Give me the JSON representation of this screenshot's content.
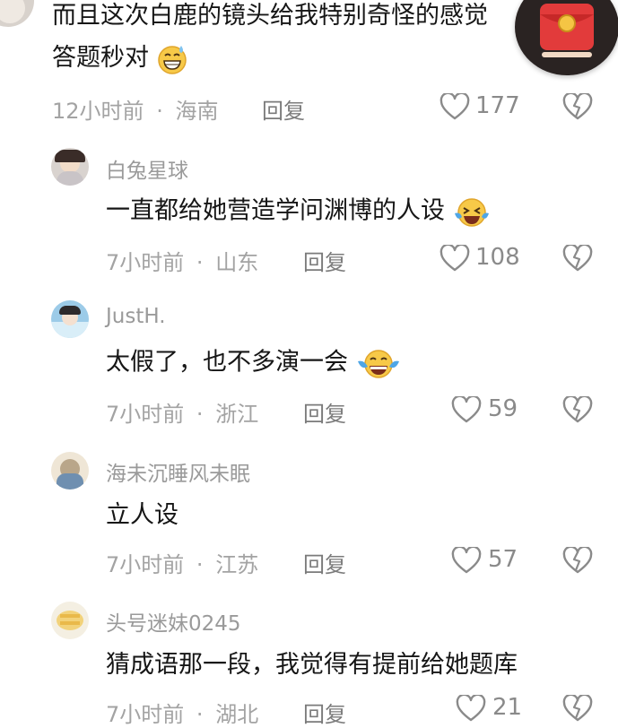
{
  "top_comment": {
    "text_line1": "而且这次白鹿的镜头给我特别奇怪的感觉",
    "text_line2": "答题秒对",
    "time": "12小时前",
    "location": "海南",
    "reply_label": "回复",
    "likes": "177"
  },
  "replies": [
    {
      "username": "白兔星球",
      "text": "一直都给她营造学问渊博的人设",
      "time": "7小时前",
      "location": "山东",
      "reply_label": "回复",
      "likes": "108"
    },
    {
      "username": "JustH.",
      "text": "太假了，也不多演一会",
      "time": "7小时前",
      "location": "浙江",
      "reply_label": "回复",
      "likes": "59"
    },
    {
      "username": "海未沉睡风未眠",
      "text": "立人设",
      "time": "7小时前",
      "location": "江苏",
      "reply_label": "回复",
      "likes": "57"
    },
    {
      "username": "头号迷妹0245",
      "text": "猜成语那一段，我觉得有提前给她题库",
      "time": "7小时前",
      "location": "湖北",
      "reply_label": "回复",
      "likes": "21"
    }
  ],
  "separator": "·",
  "icons": {
    "like": "heart-outline-icon",
    "dislike": "broken-heart-icon",
    "float": "red-envelope-icon"
  },
  "colors": {
    "accent_red": "#d8282a",
    "gold": "#f5c544"
  }
}
